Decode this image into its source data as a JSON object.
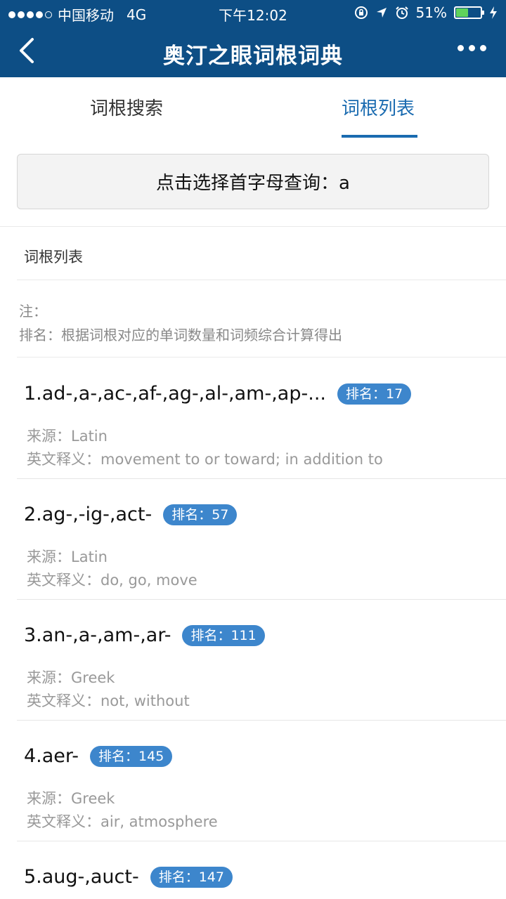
{
  "status_bar": {
    "carrier": "中国移动",
    "network": "4G",
    "time": "下午12:02",
    "battery": "51%",
    "battery_level": 0.51
  },
  "nav": {
    "title": "奥汀之眼词根词典"
  },
  "tabs": [
    {
      "label": "词根搜索",
      "active": false
    },
    {
      "label": "词根列表",
      "active": true
    }
  ],
  "letter_select": {
    "label": "点击选择首字母查询：a"
  },
  "section": {
    "title": "词根列表"
  },
  "note": {
    "line1": "注：",
    "line2": "排名：根据词根对应的单词数量和词频综合计算得出"
  },
  "entries": [
    {
      "root": "1.ad-,a-,ac-,af-,ag-,al-,am-,ap-...",
      "rank": "排名：17",
      "origin": "来源：Latin",
      "meaning": "英文释义：movement to or toward; in addition to"
    },
    {
      "root": "2.ag-,-ig-,act-",
      "rank": "排名：57",
      "origin": "来源：Latin",
      "meaning": "英文释义：do, go, move"
    },
    {
      "root": "3.an-,a-,am-,ar-",
      "rank": "排名：111",
      "origin": "来源：Greek",
      "meaning": "英文释义：not, without"
    },
    {
      "root": "4.aer-",
      "rank": "排名：145",
      "origin": "来源：Greek",
      "meaning": "英文释义：air, atmosphere"
    },
    {
      "root": "5.aug-,auct-",
      "rank": "排名：147",
      "origin": "",
      "meaning": ""
    }
  ],
  "colors": {
    "header": "#0d4e85",
    "accent": "#1a6bb0",
    "rank_badge": "#3d86cc"
  }
}
